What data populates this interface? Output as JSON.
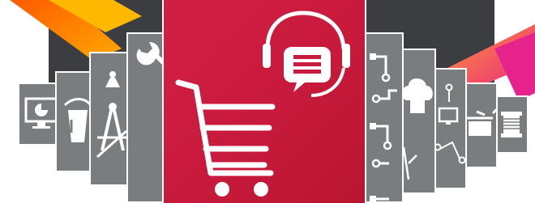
{
  "banner": {
    "hero_color": "#c91b3d",
    "tile_color": "#7a7d7f",
    "ribbon_colors": [
      "#ff7a00",
      "#ffb300",
      "#e6238c"
    ],
    "hero_icons": [
      "shopping-cart-icon",
      "headset-chat-icon"
    ],
    "left_tile_icons": [
      "monitor-chart-icon",
      "paint-bucket-icon",
      "compass-ruler-icon",
      "wrench-icon"
    ],
    "right_tile_icons": [
      "circuit-icon",
      "chef-hat-icon",
      "monitor-network-icon",
      "cooking-pot-icon",
      "thread-spool-icon"
    ]
  }
}
